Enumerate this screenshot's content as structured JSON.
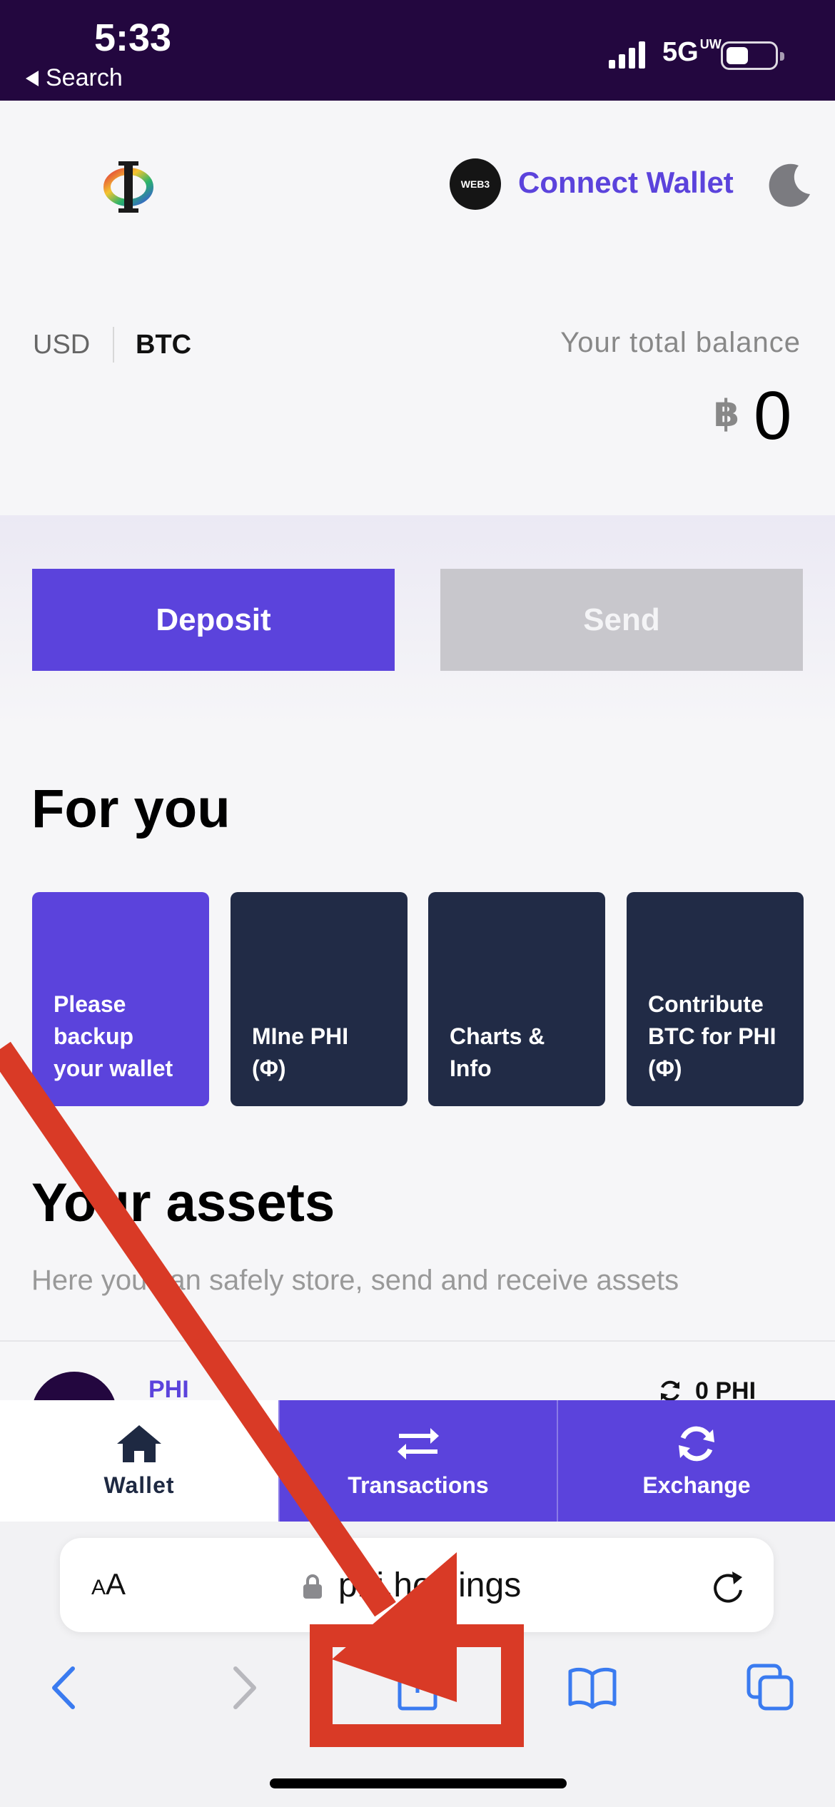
{
  "status_bar": {
    "time": "5:33",
    "back_label": "Search",
    "network": "5G",
    "network_suffix": "UW"
  },
  "header": {
    "web3_badge": "WEB3",
    "connect_wallet": "Connect Wallet"
  },
  "balance": {
    "currency_usd": "USD",
    "currency_btc": "BTC",
    "label": "Your total balance",
    "symbol": "฿",
    "value": "0"
  },
  "actions": {
    "deposit": "Deposit",
    "send": "Send"
  },
  "for_you": {
    "title": "For you",
    "cards": [
      {
        "label": "Please backup your wallet"
      },
      {
        "label": "MIne PHI (Φ)"
      },
      {
        "label": "Charts & Info"
      },
      {
        "label": "Contribute BTC for PHI (Φ)"
      }
    ]
  },
  "assets": {
    "title": "Your assets",
    "subtitle": "Here you can safely store, send and receive assets",
    "items": [
      {
        "name": "PHI",
        "balance": "0 PHI"
      }
    ]
  },
  "tabs": [
    {
      "label": "Wallet",
      "icon": "home-icon"
    },
    {
      "label": "Transactions",
      "icon": "arrows-swap-icon"
    },
    {
      "label": "Exchange",
      "icon": "sync-icon"
    }
  ],
  "browser": {
    "text_size_small": "A",
    "text_size_large": "A",
    "url": "phi.holdings"
  },
  "colors": {
    "accent": "#5b43dc",
    "status_bar": "#23073f",
    "card_dark": "#212b46",
    "annotation": "#d93a26"
  }
}
